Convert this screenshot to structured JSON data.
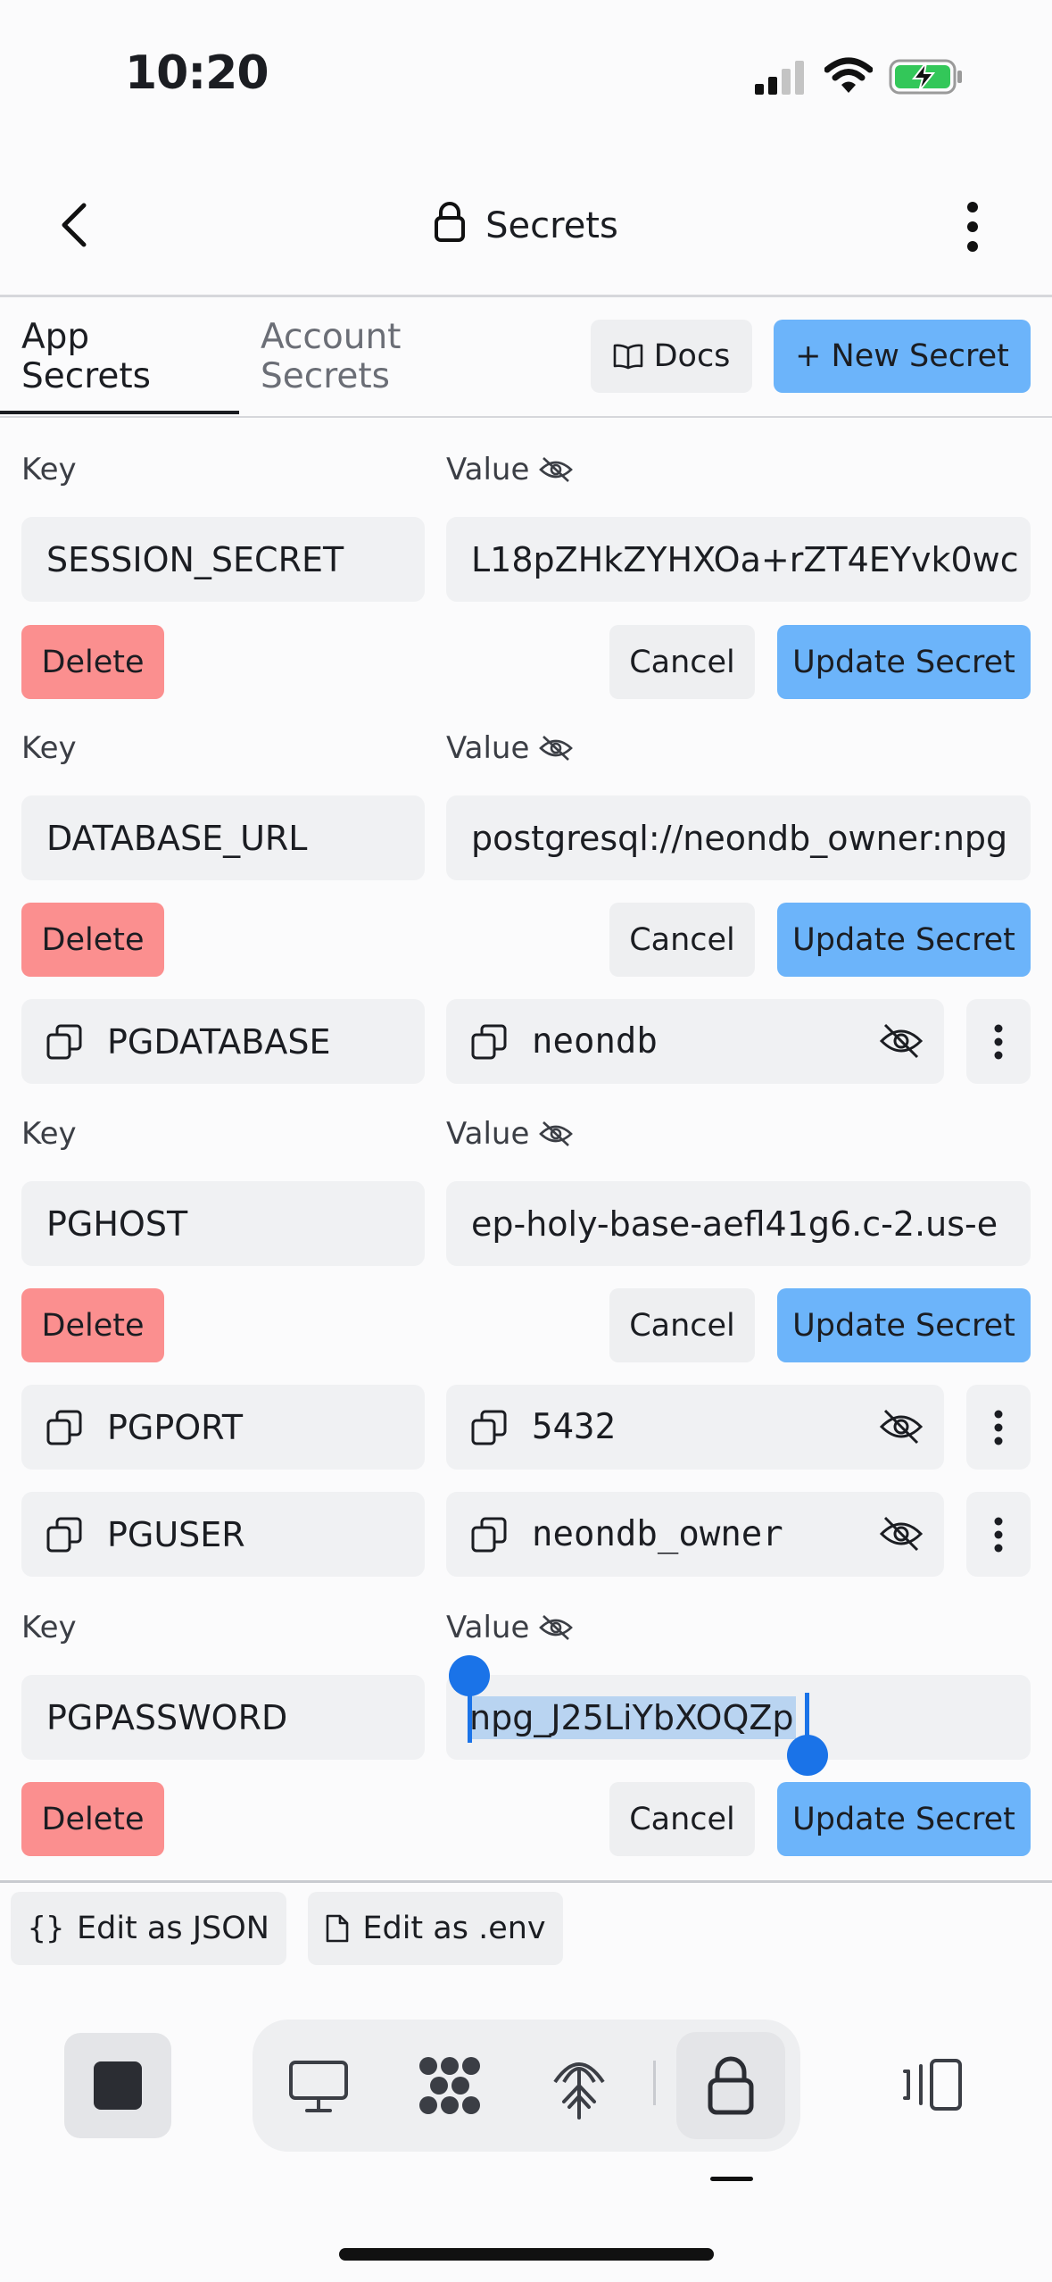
{
  "status_bar": {
    "time": "10:20"
  },
  "header": {
    "title": "Secrets"
  },
  "tabs": [
    {
      "label": "App Secrets",
      "line1": "App",
      "line2": "Secrets",
      "active": true
    },
    {
      "label": "Account Secrets",
      "line1": "Account",
      "line2": "Secrets",
      "active": false
    }
  ],
  "toolbar": {
    "docs_label": "Docs",
    "new_secret_label": "+ New Secret"
  },
  "labels": {
    "key": "Key",
    "value": "Value"
  },
  "buttons": {
    "delete": "Delete",
    "cancel": "Cancel",
    "update": "Update Secret"
  },
  "secrets": [
    {
      "key": "SESSION_SECRET",
      "value": "L18pZHkZYHXOa+rZT4EYvk0wc",
      "editing": true
    },
    {
      "key": "DATABASE_URL",
      "value": "postgresql://neondb_owner:npg",
      "editing": true
    },
    {
      "key": "PGDATABASE",
      "value": "neondb",
      "editing": false
    },
    {
      "key": "PGHOST",
      "value": "ep-holy-base-aefl41g6.c-2.us-e",
      "editing": true
    },
    {
      "key": "PGPORT",
      "value": "5432",
      "editing": false
    },
    {
      "key": "PGUSER",
      "value": "neondb_owner",
      "editing": false
    },
    {
      "key": "PGPASSWORD",
      "value": "npg_J25LiYbXOQZp",
      "editing": true,
      "selected": true
    }
  ],
  "footer": {
    "edit_json": "Edit as JSON",
    "edit_env": "Edit as .env"
  },
  "dock": {
    "items": [
      "stop-icon",
      "desktop-icon",
      "workflows-icon",
      "deploy-antenna-icon",
      "lock-icon",
      "panels-icon"
    ],
    "active": "lock-icon"
  },
  "colors": {
    "primary": "#6cb4fa",
    "danger": "#fb8f8f",
    "selection": "#1a73e8"
  }
}
